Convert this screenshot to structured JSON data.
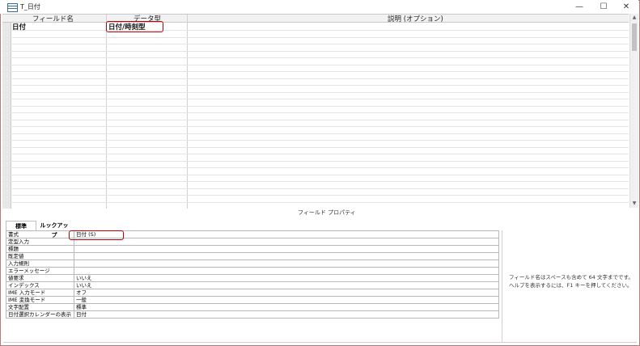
{
  "window": {
    "title": "T_日付",
    "minimize": "—",
    "maximize": "☐",
    "close": "✕"
  },
  "grid": {
    "headers": {
      "field_name": "フィールド名",
      "data_type": "データ型",
      "description": "説明 (オプション)"
    },
    "rows": [
      {
        "field_name": "日付",
        "data_type": "日付/時刻型",
        "description": ""
      }
    ]
  },
  "properties": {
    "section_label": "フィールド プロパティ",
    "tabs": [
      "標準",
      "ルックアップ"
    ],
    "rows": [
      {
        "name": "書式",
        "value": "日付 (S)"
      },
      {
        "name": "定型入力",
        "value": ""
      },
      {
        "name": "標題",
        "value": ""
      },
      {
        "name": "既定値",
        "value": ""
      },
      {
        "name": "入力規則",
        "value": ""
      },
      {
        "name": "エラーメッセージ",
        "value": ""
      },
      {
        "name": "値要求",
        "value": "いいえ"
      },
      {
        "name": "インデックス",
        "value": "いいえ"
      },
      {
        "name": "IME 入力モード",
        "value": "オフ"
      },
      {
        "name": "IME 変換モード",
        "value": "一般"
      },
      {
        "name": "文字配置",
        "value": "標準"
      },
      {
        "name": "日付選択カレンダーの表示",
        "value": "日付"
      }
    ],
    "help": "フィールド名はスペースも含めて 64 文字までです。ヘルプを表示するには、F1 キーを押してください。"
  },
  "colors": {
    "highlight": "#c00000",
    "frame": "#b87a7a"
  }
}
